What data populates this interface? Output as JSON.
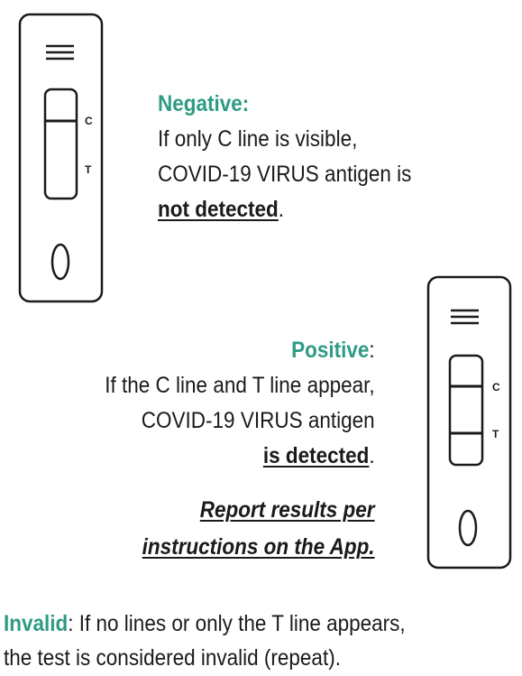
{
  "cassettes": {
    "negative": {
      "c_label": "C",
      "t_label": "T",
      "visible_lines": [
        "C"
      ]
    },
    "positive": {
      "c_label": "C",
      "t_label": "T",
      "visible_lines": [
        "C",
        "T"
      ]
    }
  },
  "negative": {
    "heading": "Negative:",
    "line1": "If only C line is visible,",
    "line2": "COVID-19 VIRUS antigen is",
    "emphasis": "not detected",
    "end": "."
  },
  "positive": {
    "heading": "Positive",
    "heading_suffix": ":",
    "line1": "If the C line and T line appear,",
    "line2": "COVID-19 VIRUS antigen",
    "emphasis": "is detected",
    "end": "."
  },
  "report": {
    "line1": "Report results per",
    "line2": "instructions on the App."
  },
  "invalid": {
    "heading": "Invalid",
    "text1": ": If no lines or only the T line appears,",
    "text2": "the test is considered invalid (repeat)."
  },
  "colors": {
    "heading": "#2e9b84",
    "ink": "#1a1a1a"
  }
}
